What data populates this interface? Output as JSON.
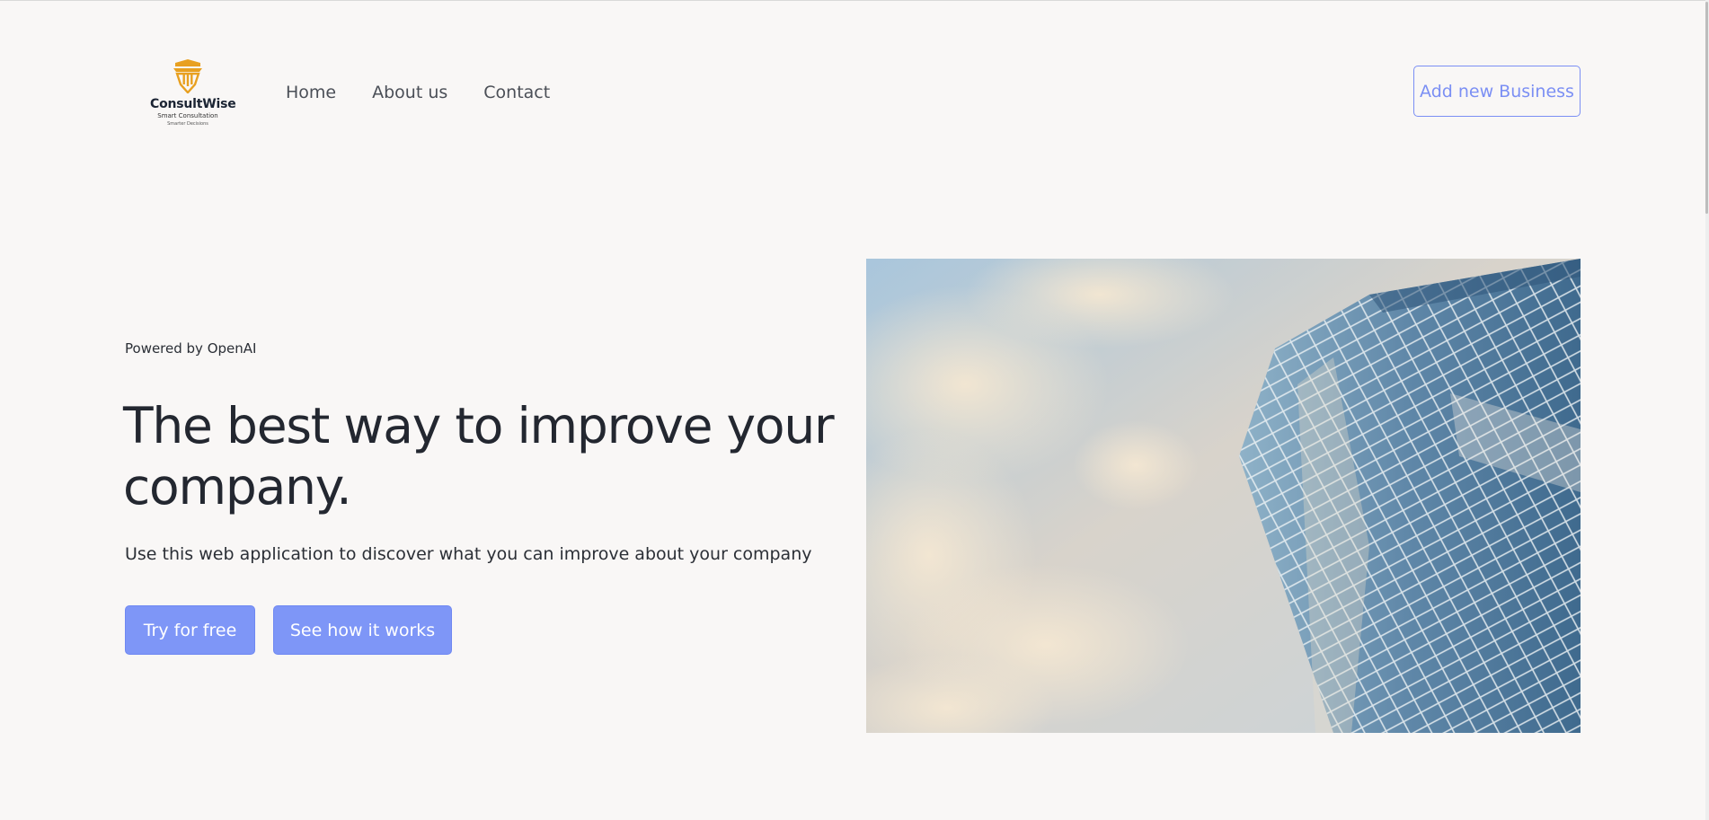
{
  "header": {
    "logo": {
      "brand": "ConsultWise",
      "tagline": "Smart Consultation",
      "subtagline": "Smarter Decisions"
    },
    "nav": [
      {
        "label": "Home"
      },
      {
        "label": "About us"
      },
      {
        "label": "Contact"
      }
    ],
    "cta_label": "Add new Business"
  },
  "hero": {
    "powered_by": "Powered by OpenAI",
    "headline": "The best way to improve your company.",
    "subtext": "Use this web application to discover what you can improve about your company",
    "primary_button": "Try for free",
    "secondary_button": "See how it works",
    "image_icon": "skyscraper-photo"
  },
  "colors": {
    "background": "#f9f7f6",
    "accent": "#7e96f7",
    "logo_gold": "#e8a020",
    "text": "#232730"
  }
}
